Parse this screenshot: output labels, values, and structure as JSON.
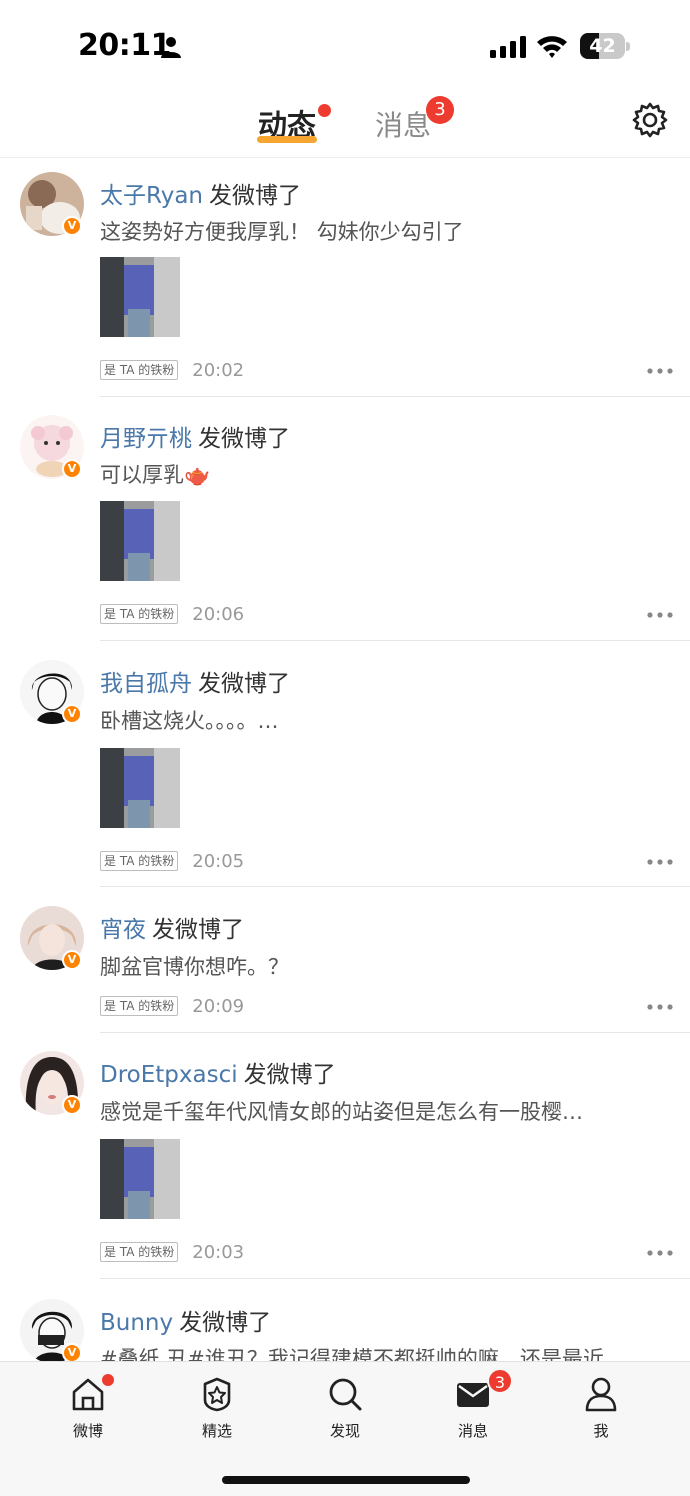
{
  "status_bar": {
    "time": "20:11",
    "battery": "42",
    "battery_level": 0.42
  },
  "top_nav": {
    "tabs": [
      {
        "label": "动态",
        "active": true,
        "has_dot": true
      },
      {
        "label": "消息",
        "active": false,
        "badge": "3"
      }
    ],
    "accent_color": "#f7a531",
    "settings_icon": "gear-icon"
  },
  "posts": [
    {
      "user": "太子Ryan",
      "action": "发微博了",
      "text": "这姿势好方便我厚乳！  勾妹你少勾引了",
      "has_image": true,
      "badge": "是 TA 的铁粉",
      "time": "20:02",
      "avatar_color": "#c9a88d"
    },
    {
      "user": "月野亓桃",
      "action": "发微博了",
      "text": "可以厚乳🫖",
      "has_image": true,
      "badge": "是 TA 的铁粉",
      "time": "20:06",
      "avatar_color": "#f3e6ea"
    },
    {
      "user": "我自孤舟",
      "action": "发微博了",
      "text": "卧槽这烧火。。。。…",
      "has_image": true,
      "badge": "是 TA 的铁粉",
      "time": "20:05",
      "avatar_color": "#f2f2f2"
    },
    {
      "user": "宵夜",
      "action": "发微博了",
      "text": "脚盆官博你想咋。？",
      "has_image": false,
      "badge": "是 TA 的铁粉",
      "time": "20:09",
      "avatar_color": "#d9c7c0"
    },
    {
      "user": "DroEtpxasci",
      "action": "发微博了",
      "text": "感觉是千玺年代风情女郎的站姿但是怎么有一股樱…",
      "has_image": true,
      "badge": "是 TA 的铁粉",
      "time": "20:03",
      "avatar_color": "#e8d5d0"
    },
    {
      "user": "Bunny",
      "action": "发微博了",
      "text": "#叠纸 丑#谁丑？我记得建模不都挺帅的嘛，还是最近",
      "has_image": false,
      "badge": "",
      "time": "",
      "avatar_color": "#eeeeee"
    }
  ],
  "bottom_nav": {
    "items": [
      {
        "label": "微博",
        "icon": "home-icon",
        "has_dot": true
      },
      {
        "label": "精选",
        "icon": "star-icon"
      },
      {
        "label": "发现",
        "icon": "search-icon"
      },
      {
        "label": "消息",
        "icon": "mail-icon",
        "badge": "3"
      },
      {
        "label": "我",
        "icon": "person-icon"
      }
    ]
  }
}
